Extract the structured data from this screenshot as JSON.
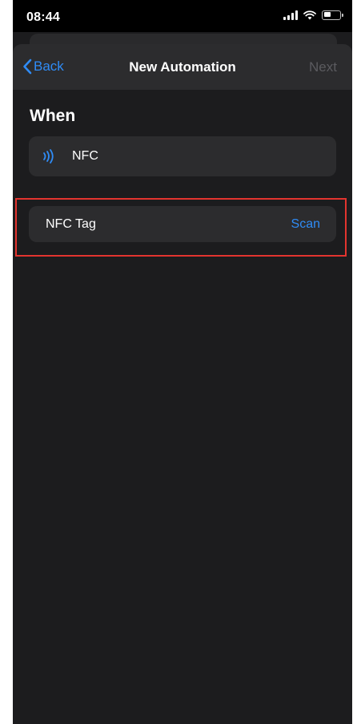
{
  "status_bar": {
    "time": "08:44",
    "icons": [
      "signal-icon",
      "wifi-icon",
      "battery-icon"
    ]
  },
  "nav": {
    "back_label": "Back",
    "title": "New Automation",
    "next_label": "Next"
  },
  "section": {
    "header": "When"
  },
  "trigger": {
    "icon": "nfc-icon",
    "label": "NFC"
  },
  "nfc_tag": {
    "label": "NFC Tag",
    "action_label": "Scan"
  },
  "colors": {
    "accent": "#2f8cf6",
    "background": "#1c1c1e",
    "cell": "#2c2c2e",
    "disabled": "#5b5b5f",
    "highlight": "#e3342f"
  }
}
